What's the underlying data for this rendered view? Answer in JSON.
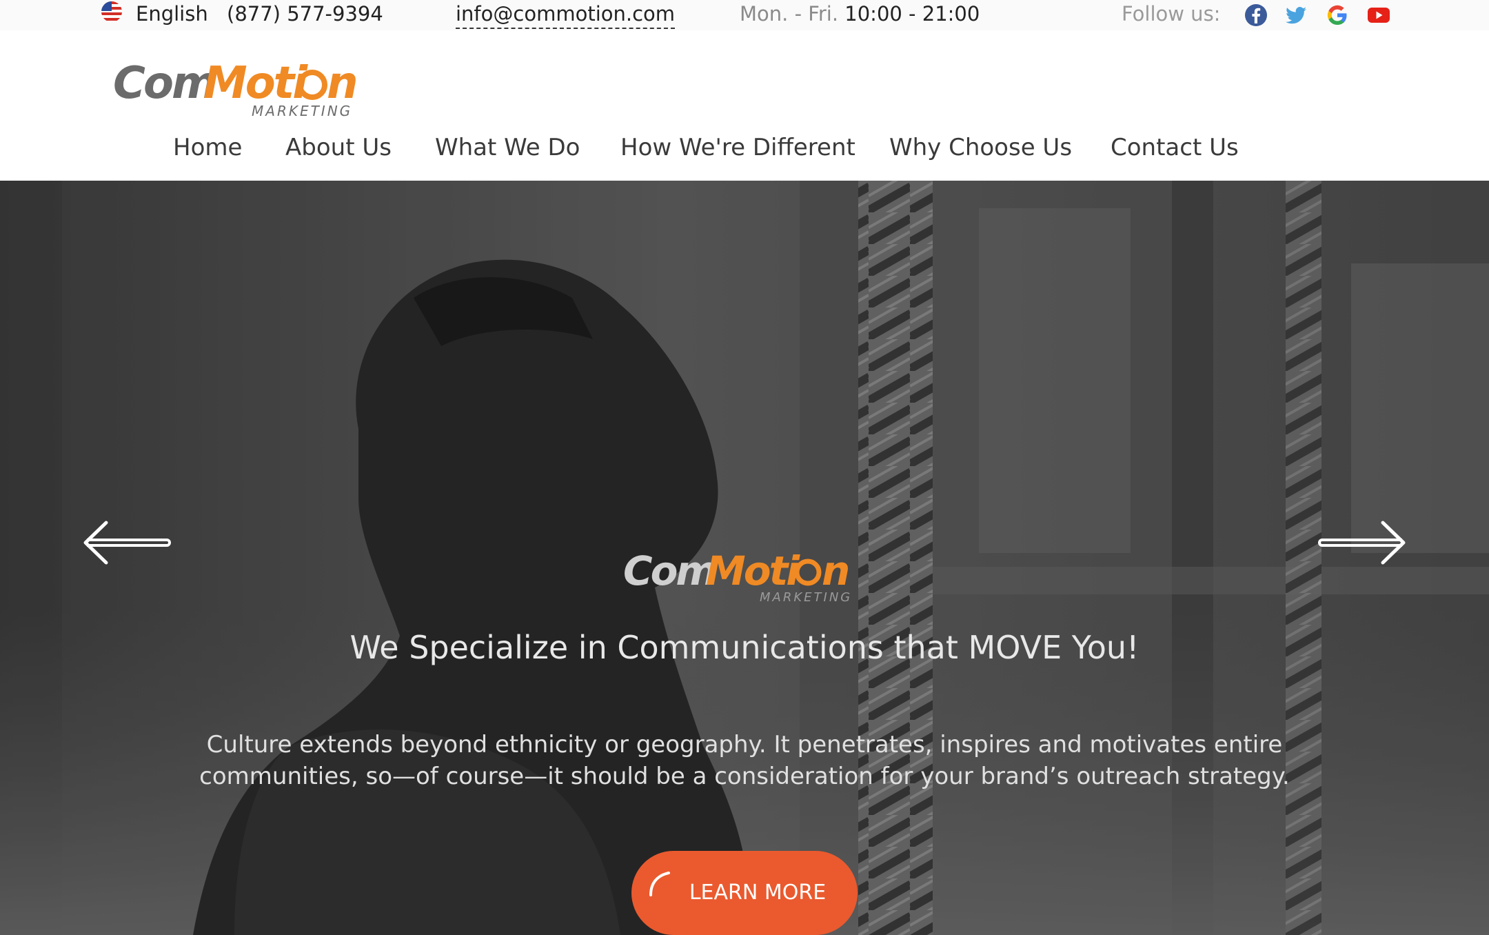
{
  "topbar": {
    "language": "English",
    "phone": "(877) 577-9394",
    "email": "info@commotion.com",
    "hours_days": "Mon. - Fri.",
    "hours_time": "10:00 - 21:00",
    "follow_label": "Follow us:",
    "social": [
      "facebook-icon",
      "twitter-icon",
      "google-icon",
      "youtube-icon"
    ]
  },
  "brand": {
    "name_part1": "Com",
    "name_part2": "Moti",
    "name_part3": "n",
    "tagline": "MARKETING",
    "accent_color": "#f08a24",
    "grey_color": "#6b6b6b"
  },
  "nav": {
    "items": [
      "Home",
      "About Us",
      "What We Do",
      "How We're Different",
      "Why Choose Us",
      "Contact Us"
    ]
  },
  "hero": {
    "headline": "We Specialize in Communications that MOVE You!",
    "body": "Culture extends beyond ethnicity or geography. It penetrates, inspires and motivates entire communities, so—of course—it should be a consideration for your brand’s outreach strategy.",
    "cta_label": "LEARN MORE",
    "cta_color": "#ea5a2e"
  }
}
